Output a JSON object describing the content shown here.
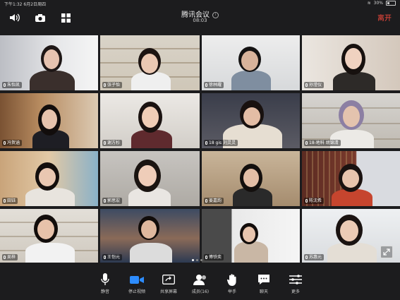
{
  "status_bar": {
    "time": "下午1:32",
    "date": "6月2日周四",
    "battery": "30%"
  },
  "top_bar": {
    "title": "腾讯会议",
    "timer": "08:03",
    "leave_label": "离开"
  },
  "icons": [
    "speaker-icon",
    "camera-switch-icon",
    "grid-view-icon"
  ],
  "participants": [
    {
      "name": "朱怡凯"
    },
    {
      "name": "张子怡"
    },
    {
      "name": "徐林耀"
    },
    {
      "name": "孙滢仪"
    },
    {
      "name": "冯贺涵"
    },
    {
      "name": "谢方杉"
    },
    {
      "name": "18 gis 刘灵灵"
    },
    {
      "name": "18-地科 胡锦清"
    },
    {
      "name": "田钰"
    },
    {
      "name": "郭思宏"
    },
    {
      "name": "姜嘉韵"
    },
    {
      "name": "陈沈希"
    },
    {
      "name": "吴梓"
    },
    {
      "name": "王恺元"
    },
    {
      "name": "傅铁奕"
    },
    {
      "name": "苏惠元"
    }
  ],
  "toolbar": {
    "mute_label": "静音",
    "stop_video_label": "停止视频",
    "share_label": "共享屏幕",
    "members_label": "成员(16)",
    "raise_hand_label": "举手",
    "chat_label": "聊天",
    "more_label": "更多"
  },
  "colors": {
    "active_speaker": "#7cd46a",
    "leave": "#ff4b3e",
    "video_icon": "#2d8cff"
  }
}
